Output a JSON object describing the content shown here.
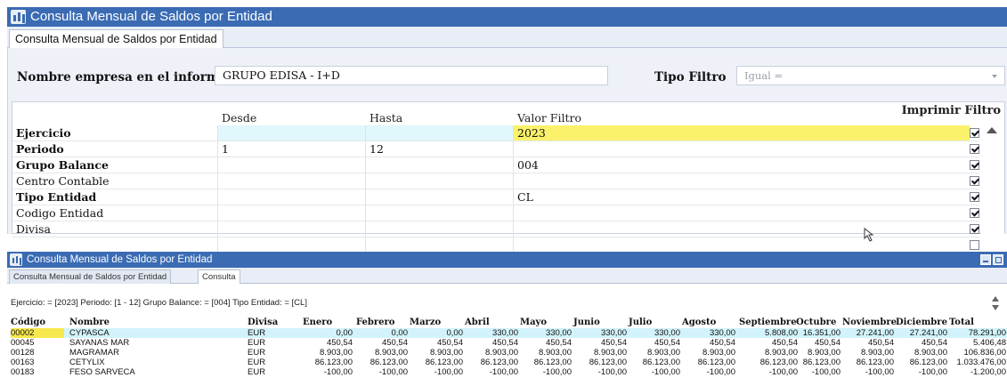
{
  "window1": {
    "title": "Consulta Mensual de Saldos por Entidad",
    "tab": "Consulta Mensual de Saldos por Entidad",
    "empresa_label": "Nombre empresa en el informe",
    "empresa_value": "GRUPO EDISA - I+D",
    "tipo_filtro_label": "Tipo Filtro",
    "tipo_filtro_value": "Igual =",
    "headers": {
      "desde": "Desde",
      "hasta": "Hasta",
      "valor": "Valor Filtro",
      "imprimir": "Imprimir Filtro"
    },
    "rows": [
      {
        "label": "Ejercicio",
        "bold": true,
        "desde": "",
        "hasta": "",
        "valor": "2023",
        "checked": true
      },
      {
        "label": "Periodo",
        "bold": true,
        "desde": "1",
        "hasta": "12",
        "valor": "",
        "checked": true
      },
      {
        "label": "Grupo Balance",
        "bold": true,
        "desde": "",
        "hasta": "",
        "valor": "004",
        "checked": true
      },
      {
        "label": "Centro Contable",
        "bold": false,
        "desde": "",
        "hasta": "",
        "valor": "",
        "checked": true
      },
      {
        "label": "Tipo Entidad",
        "bold": true,
        "desde": "",
        "hasta": "",
        "valor": "CL",
        "checked": true
      },
      {
        "label": "Codigo Entidad",
        "bold": false,
        "desde": "",
        "hasta": "",
        "valor": "",
        "checked": true
      },
      {
        "label": "Divisa",
        "bold": false,
        "desde": "",
        "hasta": "",
        "valor": "",
        "checked": true
      },
      {
        "label": "",
        "bold": false,
        "desde": "",
        "hasta": "",
        "valor": "",
        "checked": false
      }
    ]
  },
  "window2": {
    "title": "Consulta Mensual de Saldos por Entidad",
    "tabs": [
      "Consulta Mensual de Saldos por Entidad",
      "Consulta"
    ],
    "summary": "Ejercicio: = [2023] Periodo: [1 - 12] Grupo Balance: = [004] Tipo Entidad: = [CL]",
    "columns": [
      "Código",
      "Nombre",
      "Divisa",
      "Enero",
      "Febrero",
      "Marzo",
      "Abril",
      "Mayo",
      "Junio",
      "Julio",
      "Agosto",
      "Septiembre",
      "Octubre",
      "Noviembre",
      "Diciembre",
      "Total"
    ],
    "rows": [
      [
        "00002",
        "CYPASCA",
        "EUR",
        "0,00",
        "0,00",
        "0,00",
        "330,00",
        "330,00",
        "330,00",
        "330,00",
        "330,00",
        "5.808,00",
        "16.351,00",
        "27.241,00",
        "27.241,00",
        "78.291,00"
      ],
      [
        "00045",
        "SAYANAS MAR",
        "EUR",
        "450,54",
        "450,54",
        "450,54",
        "450,54",
        "450,54",
        "450,54",
        "450,54",
        "450,54",
        "450,54",
        "450,54",
        "450,54",
        "450,54",
        "5.406,48"
      ],
      [
        "00128",
        "MAGRAMAR",
        "EUR",
        "8.903,00",
        "8.903,00",
        "8.903,00",
        "8.903,00",
        "8.903,00",
        "8.903,00",
        "8.903,00",
        "8.903,00",
        "8.903,00",
        "8.903,00",
        "8.903,00",
        "8.903,00",
        "106.836,00"
      ],
      [
        "00163",
        "CETYLIX",
        "EUR",
        "86.123,00",
        "86.123,00",
        "86.123,00",
        "86.123,00",
        "86.123,00",
        "86.123,00",
        "86.123,00",
        "86.123,00",
        "86.123,00",
        "86.123,00",
        "86.123,00",
        "86.123,00",
        "1.033.476,00"
      ],
      [
        "00183",
        "FESO SARVECA",
        "EUR",
        "-100,00",
        "-100,00",
        "-100,00",
        "-100,00",
        "-100,00",
        "-100,00",
        "-100,00",
        "-100,00",
        "-100,00",
        "-100,00",
        "-100,00",
        "-100,00",
        "-1.200,00"
      ]
    ],
    "selected_row": 0
  },
  "colors": {
    "titlebar": "#3a6bb3",
    "highlight_yellow": "#fbf26b",
    "selection_cyan": "#d2f3fb"
  }
}
